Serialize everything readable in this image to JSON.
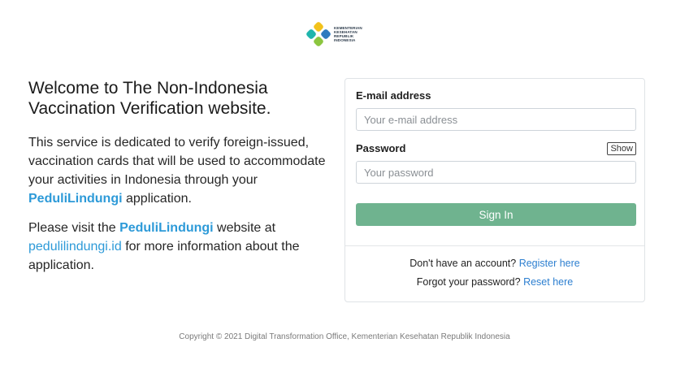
{
  "logo": {
    "icon": "ministry-logo-icon",
    "line1": "KEMENTERIAN",
    "line2": "KESEHATAN",
    "line3": "REPUBLIK",
    "line4": "INDONESIA"
  },
  "intro": {
    "welcome_line1": "Welcome to The Non-Indonesia",
    "welcome_line2": "Vaccination Verification website.",
    "p1_text": "This service is dedicated to verify foreign-issued, vaccination cards that will be used to accommodate your activities in Indonesia through your ",
    "p1_brand": "PeduliLindungi",
    "p1_end": " application.",
    "p2_start": "Please visit the ",
    "p2_brand": "PeduliLindungi",
    "p2_mid": " website at ",
    "p2_link": "pedulilindungi.id",
    "p2_end": " for more information about the application."
  },
  "form": {
    "email_label": "E-mail address",
    "email_placeholder": "Your e-mail address",
    "email_value": "",
    "password_label": "Password",
    "show_label": "Show",
    "password_placeholder": "Your password",
    "password_value": "",
    "signin_label": "Sign In"
  },
  "links": {
    "no_account_text": "Don't have an account?",
    "register_link": "Register here",
    "forgot_text": "Forgot your password?",
    "reset_link": "Reset here"
  },
  "footer": {
    "copyright": "Copyright © 2021 Digital Transformation Office, Kementerian Kesehatan Republik Indonesia"
  },
  "colors": {
    "brand_blue": "#2d9ad8",
    "signin_green": "#6fb38f",
    "logo_teal": "#1fb5ad",
    "logo_yellow": "#f2c21b",
    "logo_blue": "#2f7bbf",
    "logo_green": "#8cc63f"
  }
}
